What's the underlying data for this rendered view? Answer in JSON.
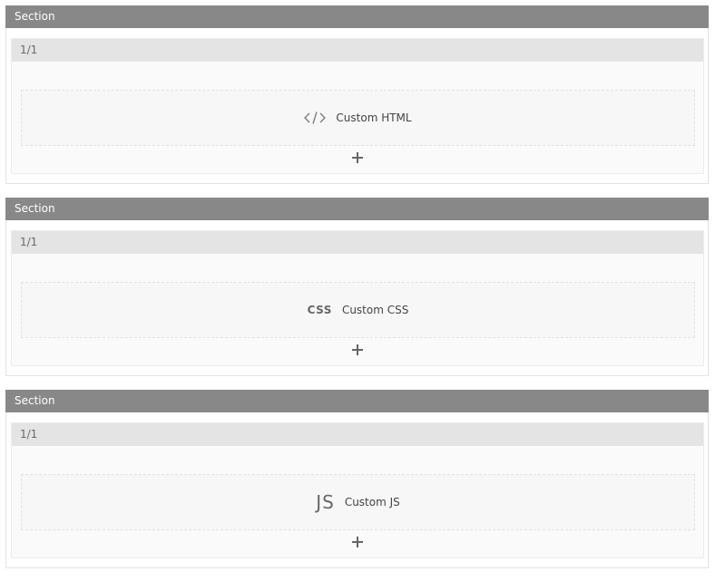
{
  "sections": [
    {
      "header": "Section",
      "column_label": "1/1",
      "element": {
        "icon": "code-icon",
        "label": "Custom HTML"
      }
    },
    {
      "header": "Section",
      "column_label": "1/1",
      "element": {
        "icon": "css-icon",
        "icon_text": "CSS",
        "label": "Custom CSS"
      }
    },
    {
      "header": "Section",
      "column_label": "1/1",
      "element": {
        "icon": "js-icon",
        "icon_text": "JS",
        "label": "Custom JS"
      }
    }
  ],
  "colors": {
    "section_header_bg": "#888888",
    "column_header_bg": "#e4e4e4",
    "column_bg": "#fafafa"
  }
}
